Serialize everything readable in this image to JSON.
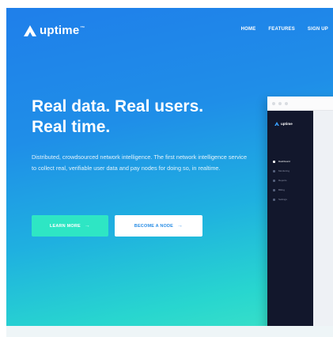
{
  "brand": {
    "name": "uptime",
    "mark": "™"
  },
  "nav": {
    "items": [
      "HOME",
      "FEATURES",
      "SIGN UP"
    ]
  },
  "hero": {
    "title_line1": "Real data. Real users.",
    "title_line2": "Real time.",
    "subtitle": "Distributed, crowdsourced network intelligence. The first network intelligence service to collect real, verifiable user data and pay nodes for doing so, in realtime.",
    "primary_button": "LEARN MORE",
    "secondary_button": "BECOME A NODE",
    "button_arrow": "→"
  },
  "app_preview": {
    "brand": "uptime",
    "sidebar_items": [
      "Dashboard",
      "Monitoring",
      "Reports",
      "Billing",
      "Settings"
    ]
  },
  "colors": {
    "gradient_start": "#1f7fea",
    "gradient_end": "#3de3c6",
    "primary_button": "#2ee6c4",
    "sidebar": "#12172c"
  }
}
